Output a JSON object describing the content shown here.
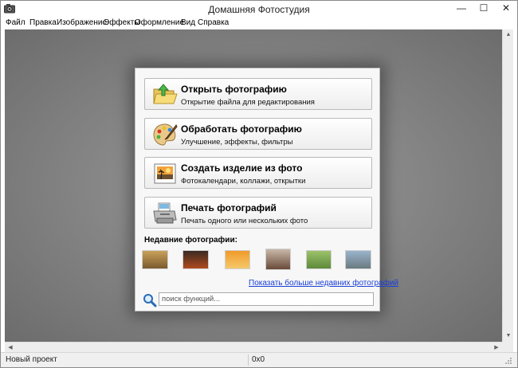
{
  "window": {
    "title": "Домашняя Фотостудия",
    "minimize_glyph": "—",
    "maximize_glyph": "☐",
    "close_glyph": "✕"
  },
  "menu": {
    "items": [
      "Файл",
      "Правка",
      "Изображение",
      "Эффекты",
      "Оформление",
      "Вид",
      "Справка"
    ]
  },
  "start_panel": {
    "actions": [
      {
        "title": "Открыть фотографию",
        "subtitle": "Открытие файла для редактирования",
        "icon": "folder-open-icon"
      },
      {
        "title": "Обработать фотографию",
        "subtitle": "Улучшение, эффекты, фильтры",
        "icon": "palette-icon"
      },
      {
        "title": "Создать изделие из фото",
        "subtitle": "Фотокалендари, коллажи, открытки",
        "icon": "picture-frame-icon"
      },
      {
        "title": "Печать фотографий",
        "subtitle": "Печать одного или нескольких фото",
        "icon": "printer-icon"
      }
    ],
    "recent_label": "Недавние фотографии:",
    "recent_thumbs": [
      {
        "name": "recent-photo-1",
        "colors": [
          "#c9a15a",
          "#7b5a2e"
        ]
      },
      {
        "name": "recent-photo-2",
        "colors": [
          "#3a2a22",
          "#b04a1e"
        ]
      },
      {
        "name": "recent-photo-3",
        "colors": [
          "#f09a2a",
          "#f5c86a"
        ]
      },
      {
        "name": "recent-photo-4",
        "colors": [
          "#c8b9a8",
          "#6a4a3a"
        ]
      },
      {
        "name": "recent-photo-5",
        "colors": [
          "#9cc26a",
          "#5d8a3a"
        ]
      },
      {
        "name": "recent-photo-6",
        "colors": [
          "#9ab4cc",
          "#6a7a80"
        ]
      }
    ],
    "more_link": "Показать больше недавних фотографий",
    "search_placeholder": "поиск функций..."
  },
  "status": {
    "project": "Новый проект",
    "coords": "0x0"
  },
  "colors": {
    "link": "#1a3fd6",
    "workspace": "#787878"
  }
}
